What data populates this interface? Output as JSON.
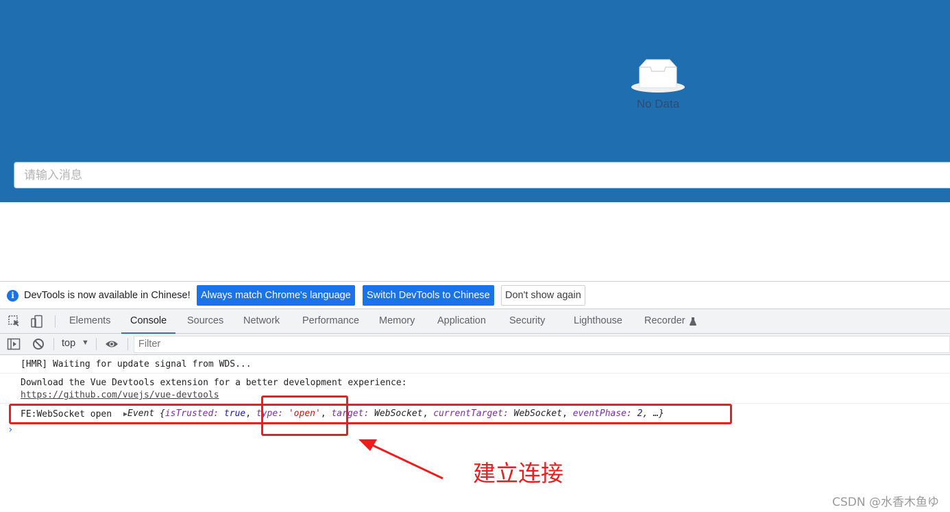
{
  "app": {
    "empty_text": "No Data",
    "input_placeholder": "请输入消息"
  },
  "devtools": {
    "infobar": {
      "message": "DevTools is now available in Chinese!",
      "btn_match": "Always match Chrome's language",
      "btn_switch": "Switch DevTools to Chinese",
      "btn_dismiss": "Don't show again"
    },
    "tabs": [
      {
        "label": "Elements"
      },
      {
        "label": "Console"
      },
      {
        "label": "Sources"
      },
      {
        "label": "Network"
      },
      {
        "label": "Performance"
      },
      {
        "label": "Memory"
      },
      {
        "label": "Application"
      },
      {
        "label": "Security"
      },
      {
        "label": "Lighthouse"
      },
      {
        "label": "Recorder"
      }
    ],
    "active_tab": "Console",
    "console_toolbar": {
      "context": "top",
      "filter_placeholder": "Filter"
    },
    "logs": {
      "hmr": "[HMR] Waiting for update signal from WDS...",
      "vue_msg": "Download the Vue Devtools extension for a better development experience:",
      "vue_link": "https://github.com/vuejs/vue-devtools",
      "ws_prefix": "FE:WebSocket open",
      "ws_event": "Event {",
      "k1": "isTrusted: ",
      "v1": "true",
      "k2": "type: ",
      "v2": "'open'",
      "k3": "target: ",
      "v3": "WebSocket",
      "k4": "currentTarget: ",
      "v4": "WebSocket",
      "k5": "eventPhase: ",
      "v5": "2",
      "tail": ", …}"
    }
  },
  "annotation": {
    "label": "建立连接",
    "color": "#ee1c1c"
  },
  "watermark": "CSDN @水香木鱼ゆ",
  "colors": {
    "app_bg": "#1f6eb0",
    "accent": "#1a73e8"
  }
}
